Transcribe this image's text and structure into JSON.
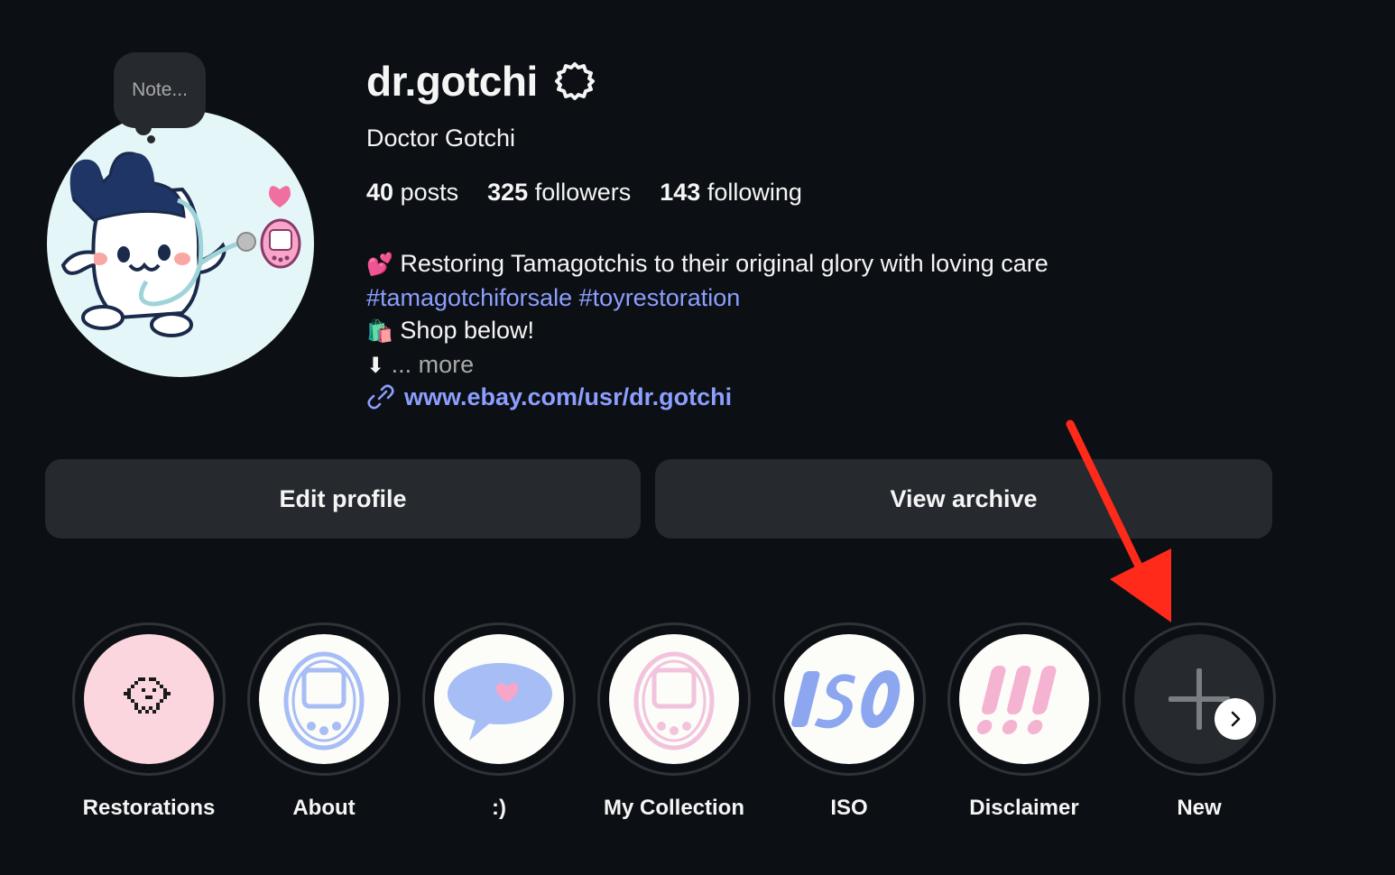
{
  "profile": {
    "note_placeholder": "Note...",
    "username": "dr.gotchi",
    "full_name": "Doctor Gotchi",
    "stats": {
      "posts_count": "40",
      "posts_label": "posts",
      "followers_count": "325",
      "followers_label": "followers",
      "following_count": "143",
      "following_label": "following"
    },
    "bio": {
      "line1_emoji": "💕",
      "line1_text": "Restoring Tamagotchis to their original glory with loving care",
      "hashtag1": "#tamagotchiforsale",
      "hashtag2": "#toyrestoration",
      "line3_emoji": "🛍️",
      "line3_text": "Shop below!",
      "line4_emoji": "⬇",
      "line4_more": "... more"
    },
    "link": "www.ebay.com/usr/dr.gotchi"
  },
  "buttons": {
    "edit_profile": "Edit profile",
    "view_archive": "View archive"
  },
  "highlights": [
    {
      "label": "Restorations",
      "icon": "pixel-pet-icon",
      "bg": "#fcd6de"
    },
    {
      "label": "About",
      "icon": "tamagotchi-device-icon",
      "bg": "#fcfcf8"
    },
    {
      "label": ":)",
      "icon": "speech-bubble-heart-icon",
      "bg": "#fcfcf8"
    },
    {
      "label": "My Collection",
      "icon": "tamagotchi-device-pink-icon",
      "bg": "#fcfcf8"
    },
    {
      "label": "ISO",
      "icon": "iso-text-icon",
      "bg": "#fcfcf8"
    },
    {
      "label": "Disclaimer",
      "icon": "exclamation-marks-icon",
      "bg": "#fcfcf8"
    },
    {
      "label": "New",
      "icon": "plus-icon",
      "bg": "#262a2f"
    }
  ],
  "colors": {
    "background": "#0c1014",
    "button_bg": "#262a2f",
    "link": "#8c9efe",
    "annotation_arrow": "#ff2a1a"
  }
}
